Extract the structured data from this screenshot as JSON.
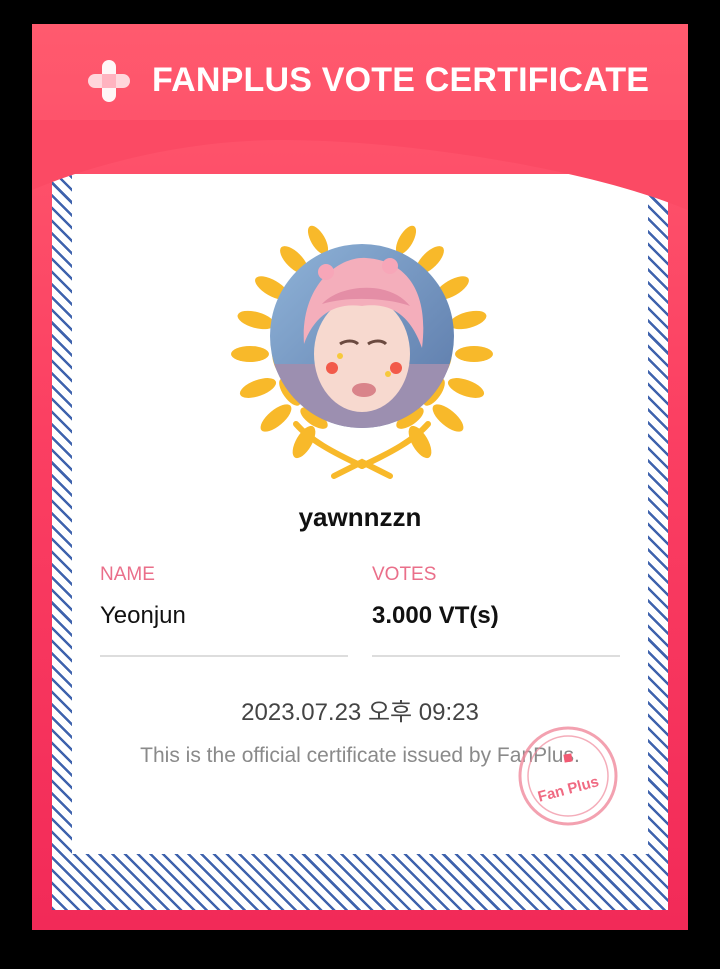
{
  "header": {
    "title": "FANPLUS VOTE CERTIFICATE",
    "logo_icon": "fanplus-plus-logo-icon"
  },
  "certificate": {
    "username": "yawnnzzn",
    "name_label": "NAME",
    "name_value": "Yeonjun",
    "votes_label": "VOTES",
    "votes_value": "3.000 VT(s)",
    "datetime": "2023.07.23 오후 09:23",
    "note": "This is the official certificate issued by FanPlus.",
    "stamp_text": "Fan Plus"
  },
  "colors": {
    "brand_pink": "#fb3f62",
    "label_pink": "#ea6f8a",
    "laurel_gold": "#f8b92a",
    "stripe_blue": "#3f63ad"
  }
}
